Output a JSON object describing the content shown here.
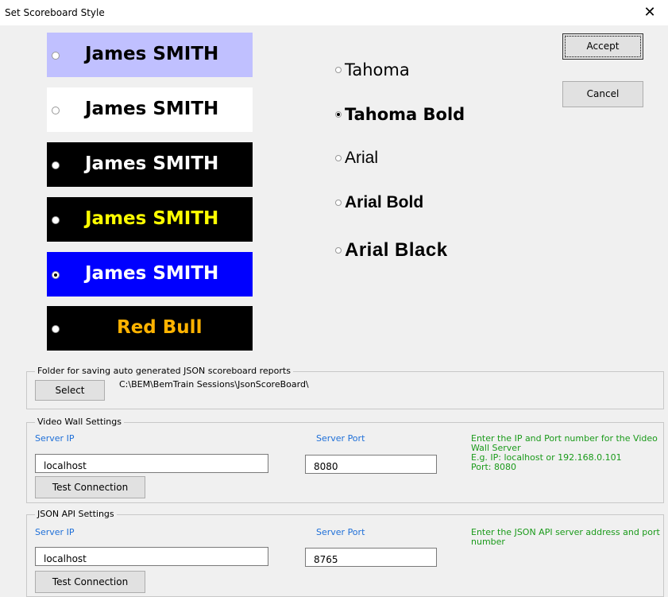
{
  "window": {
    "title": "Set Scoreboard Style",
    "close_glyph": "✕"
  },
  "swatches": [
    {
      "name": "James SMITH",
      "bg": "#c0c0ff",
      "fg": "#000000",
      "selected": false
    },
    {
      "name": "James SMITH",
      "bg": "#ffffff",
      "fg": "#000000",
      "selected": false
    },
    {
      "name": "James SMITH",
      "bg": "#000000",
      "fg": "#ffffff",
      "selected": false
    },
    {
      "name": "James SMITH",
      "bg": "#000000",
      "fg": "#ffff00",
      "selected": false
    },
    {
      "name": "James SMITH",
      "bg": "#0000ff",
      "fg": "#ffffff",
      "selected": true
    },
    {
      "name": "Red Bull",
      "bg": "#000000",
      "fg": "#ffb300",
      "selected": false
    }
  ],
  "fonts": [
    {
      "label": "Tahoma",
      "selected": false
    },
    {
      "label": "Tahoma Bold",
      "selected": true
    },
    {
      "label": "Arial",
      "selected": false
    },
    {
      "label": "Arial Bold",
      "selected": false
    },
    {
      "label": "Arial Black",
      "selected": false
    }
  ],
  "buttons": {
    "accept": "Accept",
    "cancel": "Cancel"
  },
  "folder": {
    "group_label": "Folder for saving auto generated JSON scoreboard reports",
    "select_label": "Select",
    "path": "C:\\BEM\\BemTrain Sessions\\JsonScoreBoard\\"
  },
  "video_wall": {
    "group_label": "Video Wall Settings",
    "server_ip_label": "Server IP",
    "server_ip": "localhost",
    "server_port_label": "Server Port",
    "server_port": "8080",
    "help_lines": [
      "Enter the IP and Port number for the Video",
      "Wall Server",
      "E.g. IP: localhost or 192.168.0.101",
      "Port: 8080"
    ],
    "test_label": "Test Connection"
  },
  "json_api": {
    "group_label": "JSON API Settings",
    "server_ip_label": "Server IP",
    "server_ip": "localhost",
    "server_port_label": "Server Port",
    "server_port": "8765",
    "help_lines": [
      "Enter the JSON API server address and port",
      "number"
    ],
    "test_label": "Test Connection"
  }
}
